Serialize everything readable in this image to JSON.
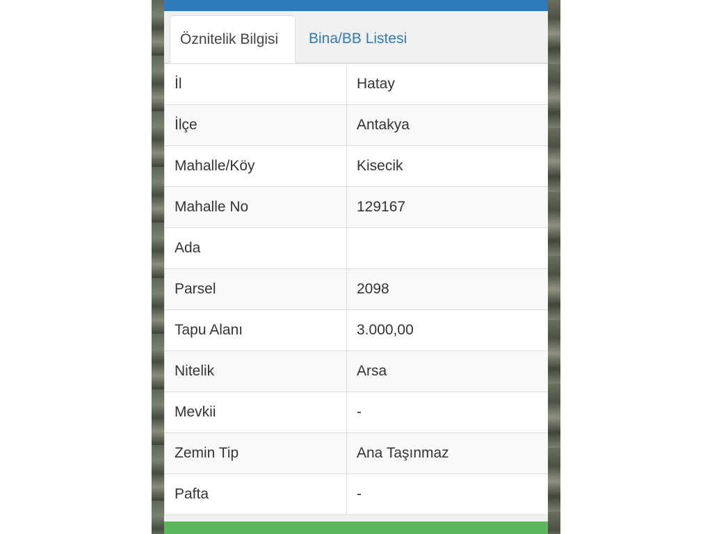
{
  "tabs": {
    "active_label": "Öznitelik Bilgisi",
    "second_label": "Bina/BB Listesi"
  },
  "attributes": [
    {
      "key": "İl",
      "value": "Hatay"
    },
    {
      "key": "İlçe",
      "value": "Antakya"
    },
    {
      "key": "Mahalle/Köy",
      "value": "Kisecik"
    },
    {
      "key": "Mahalle No",
      "value": "129167"
    },
    {
      "key": "Ada",
      "value": ""
    },
    {
      "key": "Parsel",
      "value": "2098"
    },
    {
      "key": "Tapu Alanı",
      "value": "3.000,00"
    },
    {
      "key": "Nitelik",
      "value": "Arsa"
    },
    {
      "key": "Mevkii",
      "value": "-"
    },
    {
      "key": "Zemin Tip",
      "value": "Ana Taşınmaz"
    },
    {
      "key": "Pafta",
      "value": "-"
    }
  ],
  "colors": {
    "header_blue": "#2f7ab9",
    "link_blue": "#337ab7",
    "footer_green": "#5cb85c"
  }
}
